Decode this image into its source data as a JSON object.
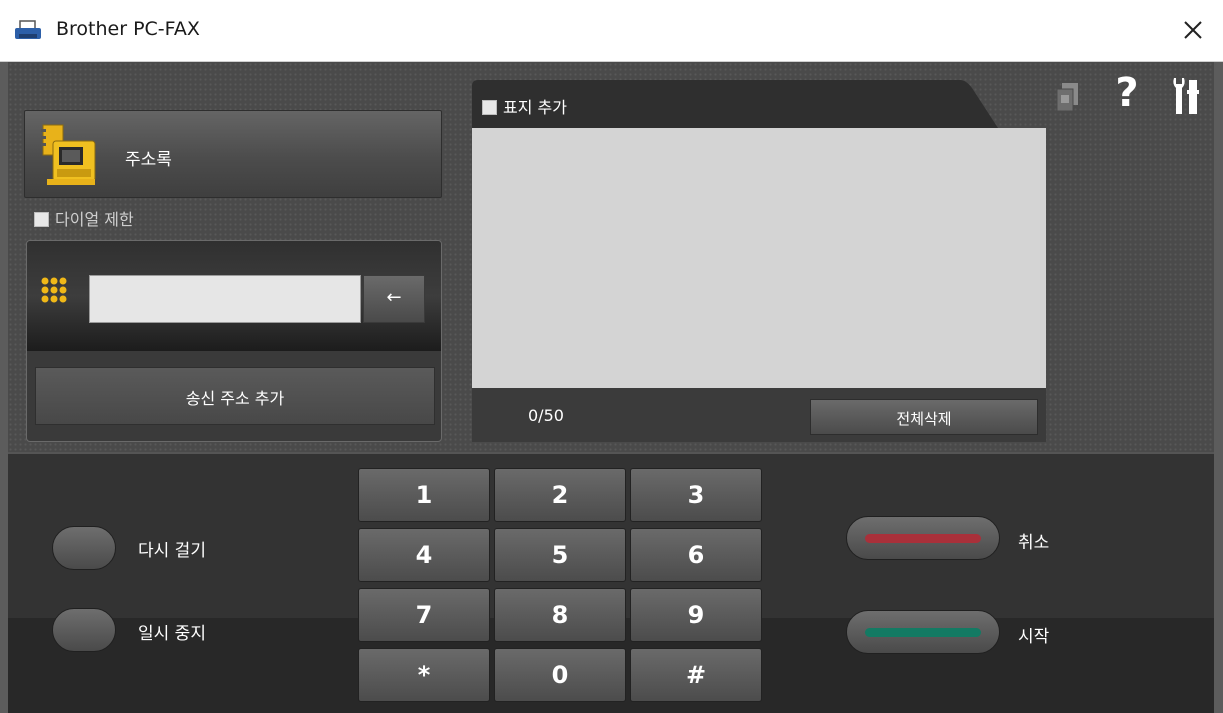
{
  "window": {
    "title": "Brother PC-FAX"
  },
  "address_book": {
    "label": "주소록"
  },
  "dial_limit": {
    "label": "다이얼 제한"
  },
  "number_entry": {
    "value": "",
    "placeholder": ""
  },
  "add_send_address": {
    "label": "송신 주소 추가"
  },
  "cover_page": {
    "label": "표지 추가"
  },
  "recipients": {
    "count": "0/50",
    "delete_all_label": "전체삭제"
  },
  "tools": {
    "help_label": "?"
  },
  "redial": {
    "label": "다시 걸기"
  },
  "pause": {
    "label": "일시 중지"
  },
  "cancel": {
    "label": "취소",
    "color": "#a9303a"
  },
  "start": {
    "label": "시작",
    "color": "#137a63"
  },
  "keypad": [
    "1",
    "2",
    "3",
    "4",
    "5",
    "6",
    "7",
    "8",
    "9",
    "*",
    "0",
    "#"
  ],
  "icons": [
    "printer-icon",
    "close-icon",
    "address-book-icon",
    "keypad-icon",
    "back-arrow-icon",
    "cover-page-icon",
    "help-icon",
    "tools-icon"
  ]
}
